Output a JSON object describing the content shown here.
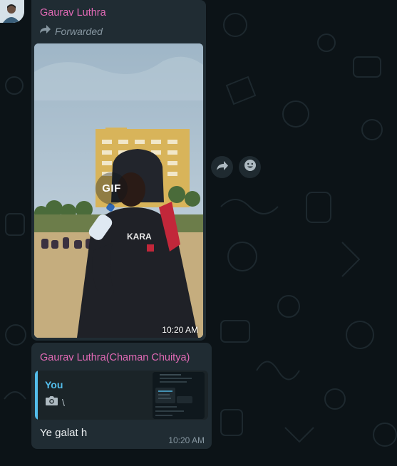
{
  "chat": {
    "message_1": {
      "sender": "Gaurav Luthra",
      "forwarded_label": "Forwarded",
      "media_badge": "GIF",
      "time": "10:20 AM"
    },
    "message_2": {
      "sender": "Gaurav Luthra(Chaman Chuitya)",
      "quote_author": "You",
      "quote_text": "\\",
      "text": "Ye galat h",
      "time": "10:20 AM"
    },
    "icons": {
      "avatar": "avatar",
      "forwarded": "forward-arrow-icon",
      "quote_media": "camera-icon",
      "action_forward": "forward-icon",
      "action_react": "emoji-icon"
    }
  },
  "colors": {
    "background": "#0c1317",
    "bubble": "#202c33",
    "sender_name": "#e26ab6",
    "quote_accent": "#53bdeb",
    "meta_text": "#8696a0",
    "text": "#e9edef"
  }
}
